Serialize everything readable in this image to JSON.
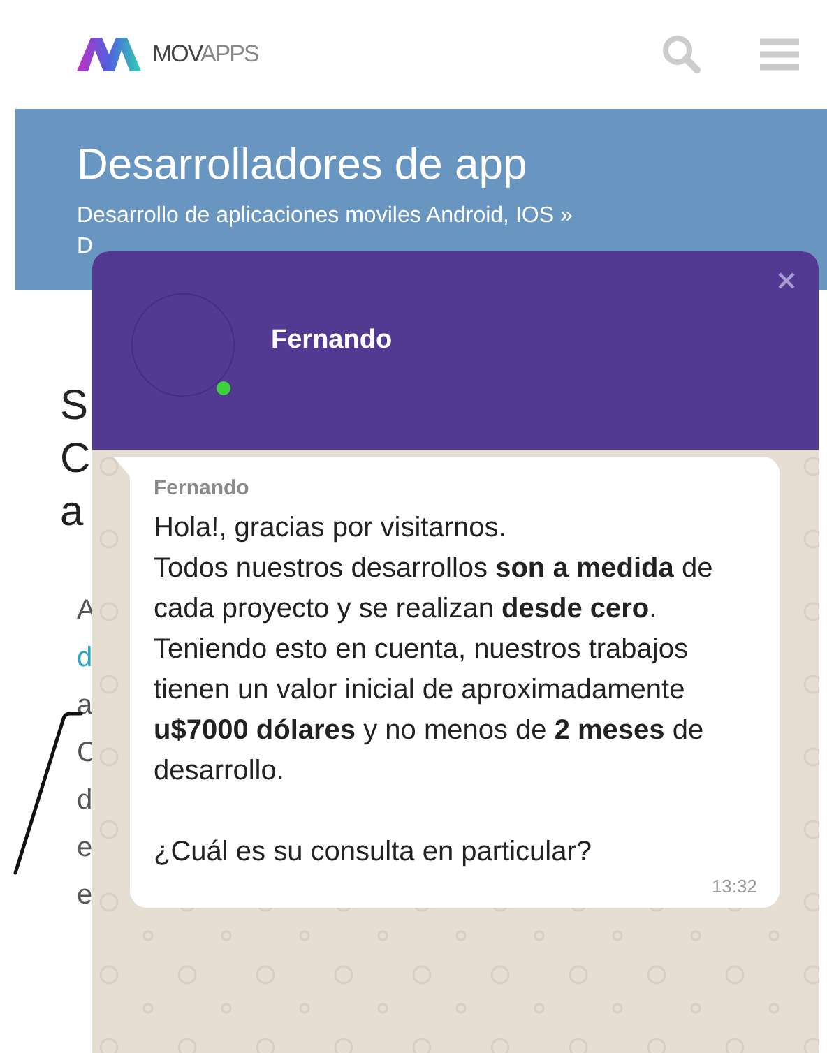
{
  "header": {
    "logo": {
      "main": "MOV",
      "light": "APPS"
    }
  },
  "banner": {
    "title": "Desarrolladores de app",
    "breadcrumb": "Desarrollo de aplicaciones moviles Android, IOS »",
    "breadcrumb_cut": "D"
  },
  "article": {
    "heading_fragments": [
      "S",
      "C",
      "a"
    ],
    "text_fragments": [
      {
        "text": "A",
        "kind": "text"
      },
      {
        "text": "d",
        "kind": "link"
      },
      {
        "text": "a",
        "kind": "text"
      },
      {
        "text": "C",
        "kind": "text"
      },
      {
        "text": "d",
        "kind": "text"
      },
      {
        "text": "e",
        "kind": "text"
      },
      {
        "text": "e",
        "kind": "text"
      }
    ]
  },
  "chat": {
    "contact": {
      "name": "Fernando",
      "online": true
    },
    "message": {
      "sender": "Fernando",
      "text": "Hola!, gracias por visitarnos.\nTodos nuestros desarrollos **son a medida** de cada proyecto y se realizan **desde cero**.\nTeniendo esto en cuenta, nuestros trabajos tienen un valor inicial de aproximadamente **u$7000 dólares** y no menos de **2 meses** de desarrollo.\n\n¿Cuál es su consulta en particular?",
      "time": "13:32"
    }
  }
}
